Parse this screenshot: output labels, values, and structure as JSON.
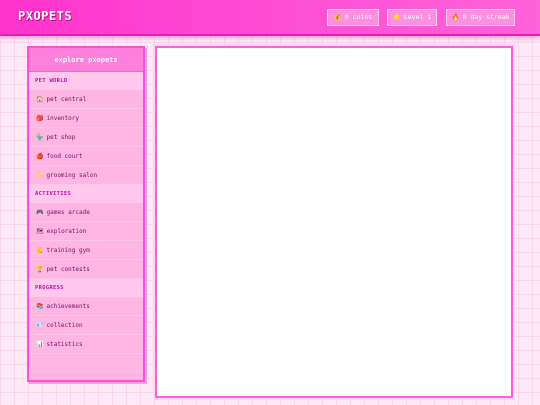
{
  "app": {
    "title": "PXOPETS"
  },
  "stats": {
    "coins": {
      "icon": "coin-icon",
      "glyph": "💰",
      "label": "0 coins"
    },
    "level": {
      "icon": "star-icon",
      "glyph": "⭐",
      "label": "Level 1"
    },
    "streak": {
      "icon": "fire-icon",
      "glyph": "🔥",
      "label": "0 day streak"
    }
  },
  "sidebar": {
    "title": "explore pxopets",
    "sections": [
      {
        "label": "PET WORLD"
      },
      {
        "label": "ACTIVITIES"
      },
      {
        "label": "PROGRESS"
      }
    ],
    "items": [
      {
        "label": "pet central",
        "icon": "house-icon",
        "glyph": "🏠"
      },
      {
        "label": "inventory",
        "icon": "backpack-icon",
        "glyph": "🎒"
      },
      {
        "label": "pet shop",
        "icon": "shop-icon",
        "glyph": "🏪"
      },
      {
        "label": "food court",
        "icon": "food-icon",
        "glyph": "🍎"
      },
      {
        "label": "grooming salon",
        "icon": "sparkle-icon",
        "glyph": "✨"
      },
      {
        "label": "games arcade",
        "icon": "gamepad-icon",
        "glyph": "🎮"
      },
      {
        "label": "exploration",
        "icon": "map-icon",
        "glyph": "🗺"
      },
      {
        "label": "training gym",
        "icon": "muscle-icon",
        "glyph": "💪"
      },
      {
        "label": "pet contests",
        "icon": "trophy-icon",
        "glyph": "🏆"
      },
      {
        "label": "achievements",
        "icon": "books-icon",
        "glyph": "📚"
      },
      {
        "label": "collection",
        "icon": "gem-icon",
        "glyph": "💎"
      },
      {
        "label": "statistics",
        "icon": "chart-icon",
        "glyph": "📊"
      }
    ]
  },
  "colors": {
    "accent": "#ff33cc",
    "sidebar_bg": "#ffb6e3",
    "section_text": "#c012a0",
    "item_text": "#7a1060"
  }
}
